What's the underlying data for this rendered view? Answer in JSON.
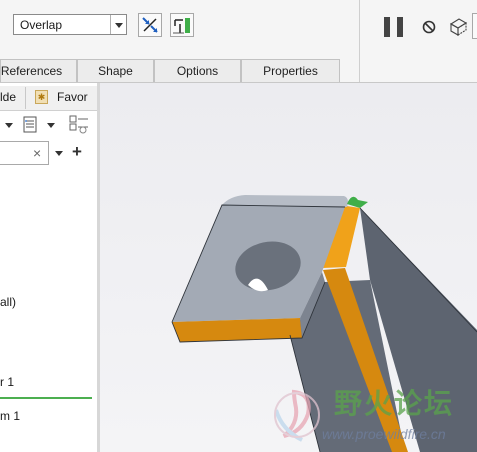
{
  "ribbon": {
    "intersection_mode": "Overlap",
    "tabs": [
      "References",
      "Shape",
      "Options",
      "Properties"
    ]
  },
  "model_tree": {
    "tabs": [
      "lde",
      "Favor"
    ],
    "partial_items": [
      "all)",
      "r 1",
      "m 1"
    ]
  },
  "watermark": {
    "title": "野火论坛",
    "url": "www.proewildfire.cn"
  },
  "colors": {
    "accent_orange": "#e39a10",
    "model_gray": "#9aa2ae",
    "selection_green": "#4caf50"
  }
}
